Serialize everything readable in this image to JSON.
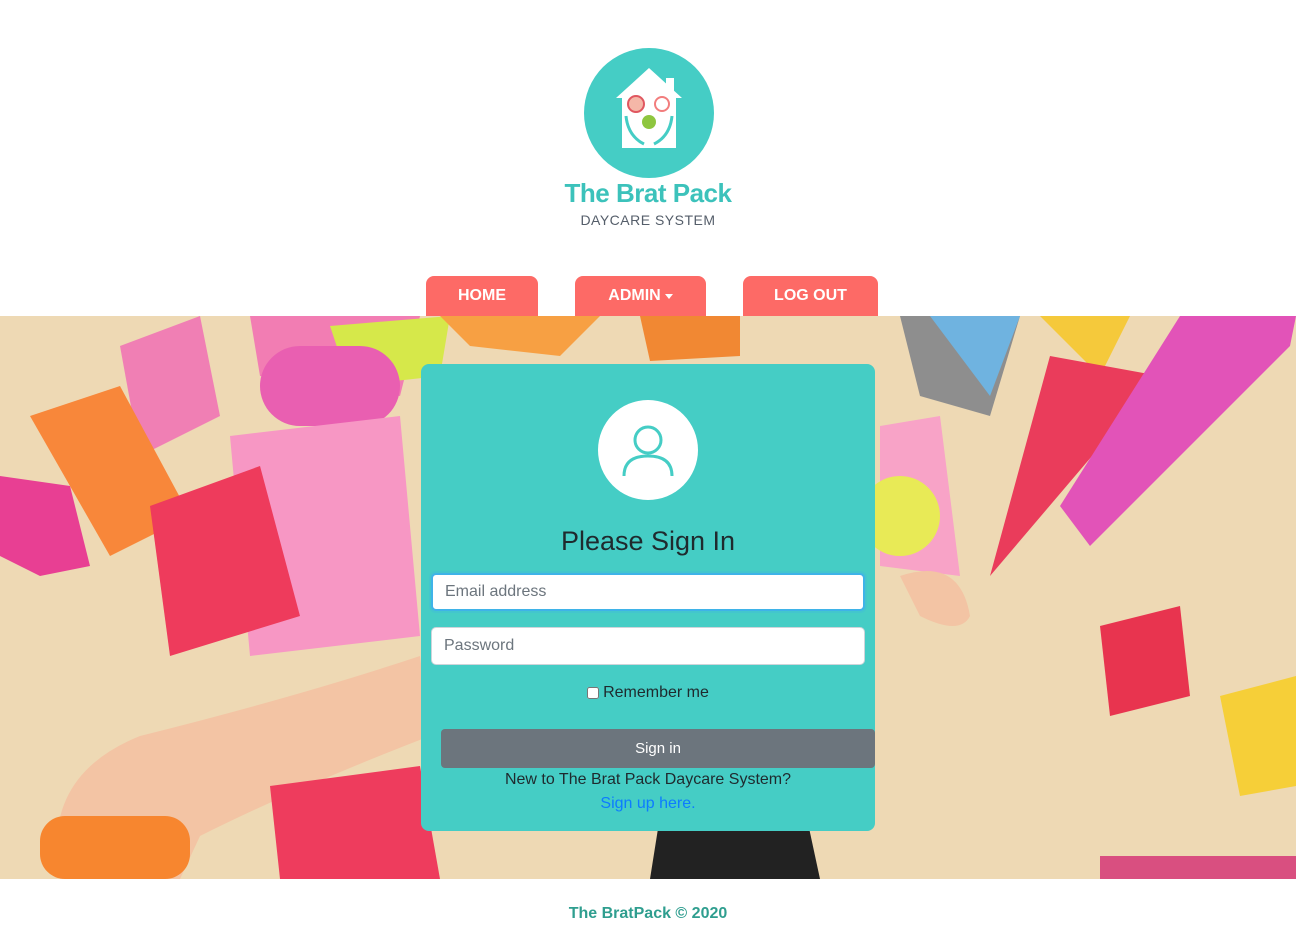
{
  "brand": {
    "name": "The Brat Pack",
    "subtitle": "DAYCARE SYSTEM"
  },
  "nav": {
    "items": [
      {
        "label": "HOME"
      },
      {
        "label": "ADMIN"
      },
      {
        "label": "LOG OUT"
      }
    ]
  },
  "login": {
    "title": "Please Sign In",
    "email_placeholder": "Email address",
    "password_placeholder": "Password",
    "remember_label": "Remember me",
    "sign_in_label": "Sign in",
    "new_text": "New to The Brat Pack Daycare System?",
    "signup_link": "Sign up here."
  },
  "footer": {
    "text": "The BratPack © 2020"
  },
  "icons": {
    "avatar": "user-icon",
    "logo": "house-hands-logo",
    "admin_caret": "caret-down-icon"
  },
  "colors": {
    "accent_teal": "#45cdc5",
    "nav_coral": "#fd6a66",
    "button_gray": "#6c757d",
    "link_blue": "#0d7bff",
    "footer_green": "#2f9e8f"
  }
}
